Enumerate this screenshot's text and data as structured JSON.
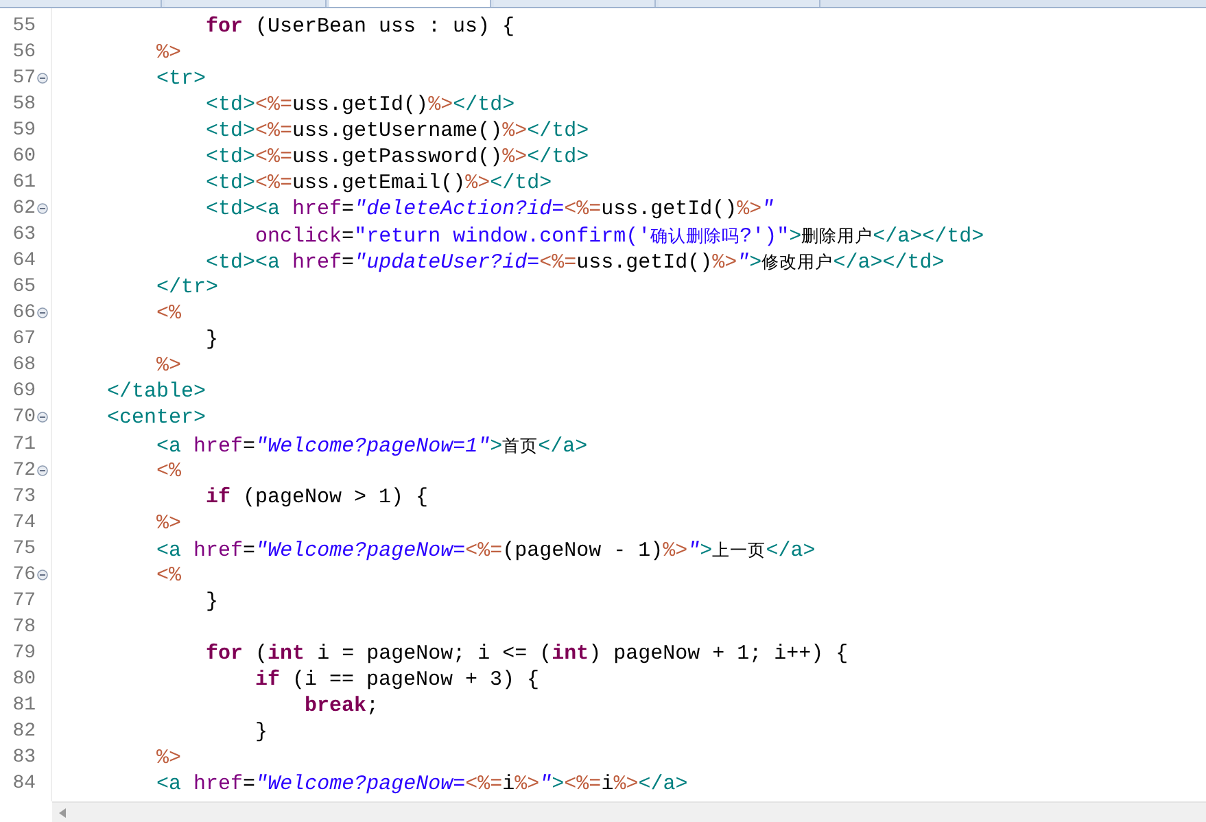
{
  "editor": {
    "lines": [
      {
        "number": "55",
        "fold": false,
        "tokens": [
          {
            "kind": "k",
            "text": "            for"
          },
          {
            "kind": "p",
            "text": " (UserBean uss : us) {"
          }
        ]
      },
      {
        "number": "56",
        "fold": false,
        "tokens": [
          {
            "kind": "j",
            "text": "        %>"
          }
        ]
      },
      {
        "number": "57",
        "fold": true,
        "tokens": [
          {
            "kind": "t",
            "text": "        <tr>"
          }
        ]
      },
      {
        "number": "58",
        "fold": false,
        "tokens": [
          {
            "kind": "t",
            "text": "            <td>"
          },
          {
            "kind": "j",
            "text": "<%="
          },
          {
            "kind": "p",
            "text": "uss.getId()"
          },
          {
            "kind": "j",
            "text": "%>"
          },
          {
            "kind": "t",
            "text": "</td>"
          }
        ]
      },
      {
        "number": "59",
        "fold": false,
        "tokens": [
          {
            "kind": "t",
            "text": "            <td>"
          },
          {
            "kind": "j",
            "text": "<%="
          },
          {
            "kind": "p",
            "text": "uss.getUsername()"
          },
          {
            "kind": "j",
            "text": "%>"
          },
          {
            "kind": "t",
            "text": "</td>"
          }
        ]
      },
      {
        "number": "60",
        "fold": false,
        "tokens": [
          {
            "kind": "t",
            "text": "            <td>"
          },
          {
            "kind": "j",
            "text": "<%="
          },
          {
            "kind": "p",
            "text": "uss.getPassword()"
          },
          {
            "kind": "j",
            "text": "%>"
          },
          {
            "kind": "t",
            "text": "</td>"
          }
        ]
      },
      {
        "number": "61",
        "fold": false,
        "tokens": [
          {
            "kind": "t",
            "text": "            <td>"
          },
          {
            "kind": "j",
            "text": "<%="
          },
          {
            "kind": "p",
            "text": "uss.getEmail()"
          },
          {
            "kind": "j",
            "text": "%>"
          },
          {
            "kind": "t",
            "text": "</td>"
          }
        ]
      },
      {
        "number": "62",
        "fold": true,
        "tokens": [
          {
            "kind": "t",
            "text": "            <td><a "
          },
          {
            "kind": "a",
            "text": "href"
          },
          {
            "kind": "p",
            "text": "="
          },
          {
            "kind": "s",
            "text": "\"deleteAction?id="
          },
          {
            "kind": "j",
            "text": "<%="
          },
          {
            "kind": "p",
            "text": "uss.getId()"
          },
          {
            "kind": "j",
            "text": "%>"
          },
          {
            "kind": "s",
            "text": "\""
          }
        ]
      },
      {
        "number": "63",
        "fold": false,
        "tokens": [
          {
            "kind": "a",
            "text": "                onclick"
          },
          {
            "kind": "p",
            "text": "="
          },
          {
            "kind": "q",
            "text": "\"return window.confirm('确认删除吗?')\""
          },
          {
            "kind": "t",
            "text": ">"
          },
          {
            "kind": "p",
            "text": "删除用户"
          },
          {
            "kind": "t",
            "text": "</a></td>"
          }
        ]
      },
      {
        "number": "64",
        "fold": false,
        "tokens": [
          {
            "kind": "t",
            "text": "            <td><a "
          },
          {
            "kind": "a",
            "text": "href"
          },
          {
            "kind": "p",
            "text": "="
          },
          {
            "kind": "s",
            "text": "\"updateUser?id="
          },
          {
            "kind": "j",
            "text": "<%="
          },
          {
            "kind": "p",
            "text": "uss.getId()"
          },
          {
            "kind": "j",
            "text": "%>"
          },
          {
            "kind": "s",
            "text": "\""
          },
          {
            "kind": "t",
            "text": ">"
          },
          {
            "kind": "p",
            "text": "修改用户"
          },
          {
            "kind": "t",
            "text": "</a></td>"
          }
        ]
      },
      {
        "number": "65",
        "fold": false,
        "tokens": [
          {
            "kind": "t",
            "text": "        </tr>"
          }
        ]
      },
      {
        "number": "66",
        "fold": true,
        "tokens": [
          {
            "kind": "j",
            "text": "        <%"
          }
        ]
      },
      {
        "number": "67",
        "fold": false,
        "tokens": [
          {
            "kind": "p",
            "text": "            }"
          }
        ]
      },
      {
        "number": "68",
        "fold": false,
        "tokens": [
          {
            "kind": "j",
            "text": "        %>"
          }
        ]
      },
      {
        "number": "69",
        "fold": false,
        "tokens": [
          {
            "kind": "t",
            "text": "    </table>"
          }
        ]
      },
      {
        "number": "70",
        "fold": true,
        "tokens": [
          {
            "kind": "t",
            "text": "    <center>"
          }
        ]
      },
      {
        "number": "71",
        "fold": false,
        "tokens": [
          {
            "kind": "t",
            "text": "        <a "
          },
          {
            "kind": "a",
            "text": "href"
          },
          {
            "kind": "p",
            "text": "="
          },
          {
            "kind": "s",
            "text": "\"Welcome?pageNow=1\""
          },
          {
            "kind": "t",
            "text": ">"
          },
          {
            "kind": "p",
            "text": "首页"
          },
          {
            "kind": "t",
            "text": "</a>"
          }
        ]
      },
      {
        "number": "72",
        "fold": true,
        "tokens": [
          {
            "kind": "j",
            "text": "        <%"
          }
        ]
      },
      {
        "number": "73",
        "fold": false,
        "tokens": [
          {
            "kind": "k",
            "text": "            if"
          },
          {
            "kind": "p",
            "text": " (pageNow > 1) {"
          }
        ]
      },
      {
        "number": "74",
        "fold": false,
        "tokens": [
          {
            "kind": "j",
            "text": "        %>"
          }
        ]
      },
      {
        "number": "75",
        "fold": false,
        "tokens": [
          {
            "kind": "t",
            "text": "        <a "
          },
          {
            "kind": "a",
            "text": "href"
          },
          {
            "kind": "p",
            "text": "="
          },
          {
            "kind": "s",
            "text": "\"Welcome?pageNow="
          },
          {
            "kind": "j",
            "text": "<%="
          },
          {
            "kind": "p",
            "text": "(pageNow - 1)"
          },
          {
            "kind": "j",
            "text": "%>"
          },
          {
            "kind": "s",
            "text": "\""
          },
          {
            "kind": "t",
            "text": ">"
          },
          {
            "kind": "p",
            "text": "上一页"
          },
          {
            "kind": "t",
            "text": "</a>"
          }
        ]
      },
      {
        "number": "76",
        "fold": true,
        "tokens": [
          {
            "kind": "j",
            "text": "        <%"
          }
        ]
      },
      {
        "number": "77",
        "fold": false,
        "tokens": [
          {
            "kind": "p",
            "text": "            }"
          }
        ]
      },
      {
        "number": "78",
        "fold": false
      },
      {
        "number": "79",
        "fold": false,
        "tokens": [
          {
            "kind": "k",
            "text": "            for"
          },
          {
            "kind": "p",
            "text": " ("
          },
          {
            "kind": "k",
            "text": "int"
          },
          {
            "kind": "p",
            "text": " i = pageNow; i <= ("
          },
          {
            "kind": "k",
            "text": "int"
          },
          {
            "kind": "p",
            "text": ") pageNow + 1; i++) {"
          }
        ]
      },
      {
        "number": "80",
        "fold": false,
        "tokens": [
          {
            "kind": "k",
            "text": "                if"
          },
          {
            "kind": "p",
            "text": " (i == pageNow + 3) {"
          }
        ]
      },
      {
        "number": "81",
        "fold": false,
        "tokens": [
          {
            "kind": "k",
            "text": "                    break"
          },
          {
            "kind": "p",
            "text": ";"
          }
        ]
      },
      {
        "number": "82",
        "fold": false,
        "tokens": [
          {
            "kind": "p",
            "text": "                }"
          }
        ]
      },
      {
        "number": "83",
        "fold": false,
        "tokens": [
          {
            "kind": "j",
            "text": "        %>"
          }
        ]
      },
      {
        "number": "84",
        "fold": false,
        "tokens": [
          {
            "kind": "t",
            "text": "        <a "
          },
          {
            "kind": "a",
            "text": "href"
          },
          {
            "kind": "p",
            "text": "="
          },
          {
            "kind": "s",
            "text": "\"Welcome?pageNow="
          },
          {
            "kind": "j",
            "text": "<%="
          },
          {
            "kind": "p",
            "text": "i"
          },
          {
            "kind": "j",
            "text": "%>"
          },
          {
            "kind": "s",
            "text": "\""
          },
          {
            "kind": "t",
            "text": ">"
          },
          {
            "kind": "j",
            "text": "<%="
          },
          {
            "kind": "p",
            "text": "i"
          },
          {
            "kind": "j",
            "text": "%>"
          },
          {
            "kind": "t",
            "text": "</a>"
          }
        ]
      }
    ]
  }
}
